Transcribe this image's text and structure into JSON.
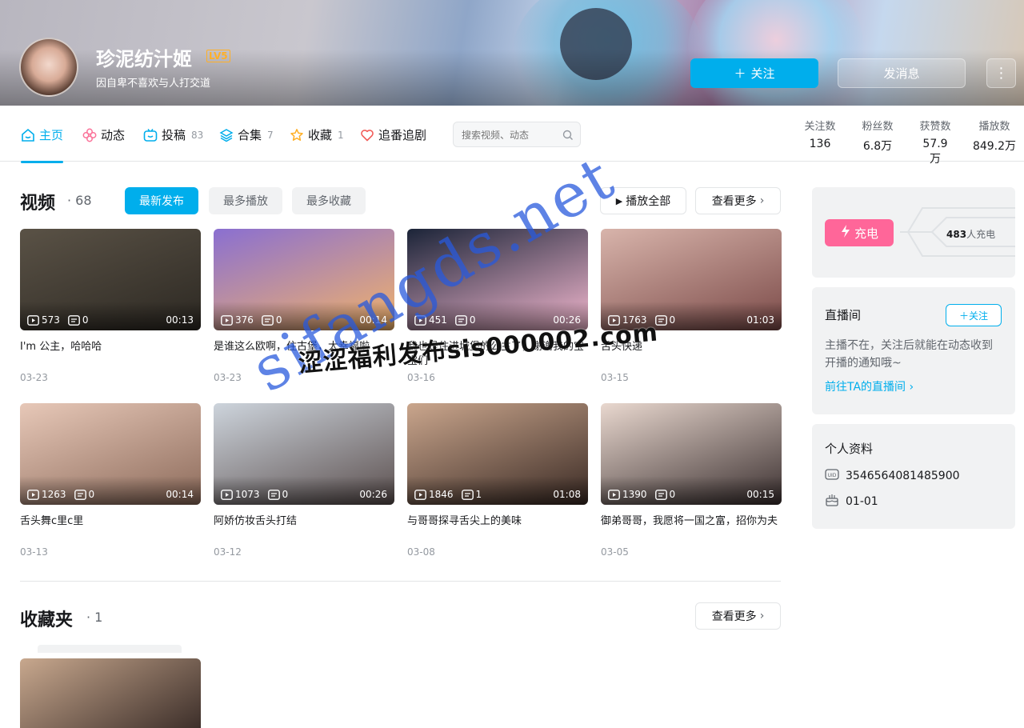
{
  "header": {
    "username": "珍泥纺汁姬",
    "level": "LV5",
    "signature": "因自卑不喜欢与人打交道",
    "follow_label": "关注",
    "message_label": "发消息"
  },
  "nav": {
    "tabs": [
      {
        "label": "主页",
        "count": ""
      },
      {
        "label": "动态",
        "count": ""
      },
      {
        "label": "投稿",
        "count": "83"
      },
      {
        "label": "合集",
        "count": "7"
      },
      {
        "label": "收藏",
        "count": "1"
      },
      {
        "label": "追番追剧",
        "count": ""
      }
    ],
    "search_placeholder": "搜索视频、动态",
    "stats": [
      {
        "label": "关注数",
        "value": "136"
      },
      {
        "label": "粉丝数",
        "value": "6.8万"
      },
      {
        "label": "获赞数",
        "value": "57.9万"
      },
      {
        "label": "播放数",
        "value": "849.2万"
      }
    ]
  },
  "videos_section": {
    "title": "视频",
    "count": "68",
    "filters": [
      "最新发布",
      "最多播放",
      "最多收藏"
    ],
    "play_all": "播放全部",
    "see_more": "查看更多",
    "items": [
      {
        "title": "I'm 公主，哈哈哈",
        "date": "03-23",
        "plays": "573",
        "danmaku": "0",
        "duration": "00:13",
        "colors": [
          "#5a5246",
          "#2c2822"
        ]
      },
      {
        "title": "是谁这么欧啊，住古堡，太幸福啦",
        "date": "03-23",
        "plays": "376",
        "danmaku": "0",
        "duration": "00:14",
        "colors": [
          "#8a6fd1",
          "#f2b36a"
        ]
      },
      {
        "title": "我也是住进城堡的公主了，谢谢我的宝宝们",
        "date": "03-16",
        "plays": "451",
        "danmaku": "0",
        "duration": "00:26",
        "colors": [
          "#1b2438",
          "#f3b8cf"
        ]
      },
      {
        "title": "舌头快递",
        "date": "03-15",
        "plays": "1763",
        "danmaku": "0",
        "duration": "01:03",
        "colors": [
          "#d8b4ab",
          "#7b4a48"
        ]
      },
      {
        "title": "舌头舞c里c里",
        "date": "03-13",
        "plays": "1263",
        "danmaku": "0",
        "duration": "00:14",
        "colors": [
          "#e7c8b8",
          "#8c6a5a"
        ]
      },
      {
        "title": "阿娇仿妆舌头打结",
        "date": "03-12",
        "plays": "1073",
        "danmaku": "0",
        "duration": "00:26",
        "colors": [
          "#cdd4dc",
          "#5b4f4e"
        ]
      },
      {
        "title": "与哥哥探寻舌尖上的美味",
        "date": "03-08",
        "plays": "1846",
        "danmaku": "1",
        "duration": "01:08",
        "colors": [
          "#caa68d",
          "#3a2a24"
        ]
      },
      {
        "title": "御弟哥哥，我愿将一国之富，招你为夫",
        "date": "03-05",
        "plays": "1390",
        "danmaku": "0",
        "duration": "00:15",
        "colors": [
          "#e9d8cf",
          "#3b3030"
        ]
      }
    ]
  },
  "favorites_section": {
    "title": "收藏夹",
    "count": "1",
    "see_more": "查看更多",
    "thumb_colors": [
      "#c8a88e",
      "#3d2f2a"
    ]
  },
  "sidebar": {
    "charge_label": "充电",
    "charge_count": "483",
    "charge_suffix": "人充电",
    "live_title": "直播间",
    "live_follow": "关注",
    "live_text": "主播不在，关注后就能在动态收到开播的通知哦~",
    "live_link": "前往TA的直播间",
    "profile_title": "个人资料",
    "uid": "3546564081485900",
    "birthday": "01-01"
  },
  "watermarks": {
    "text1": "涩涩福利发布sis000002.com",
    "text2": "sifangds.net"
  },
  "colors": {
    "accent": "#00aeec",
    "charge": "#ff6699"
  }
}
